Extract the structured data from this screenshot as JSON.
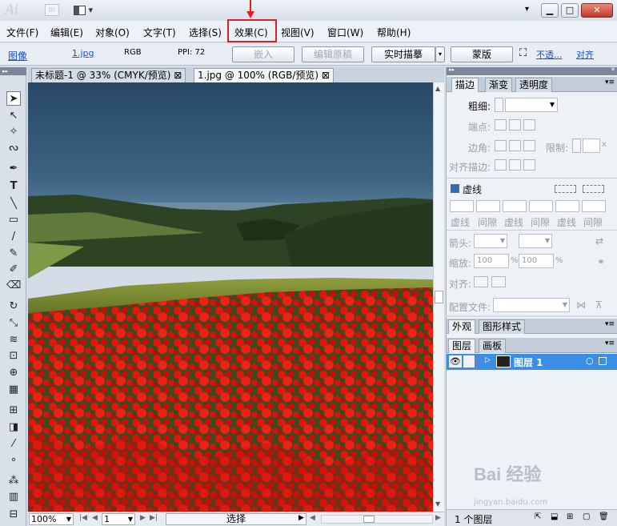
{
  "app": {
    "logo": "Ai",
    "bridge_label": "Br",
    "arrange_icon": "arrange-documents-icon"
  },
  "window_controls": {
    "minimize": "▁",
    "restore": "□",
    "close": "✕"
  },
  "menu": {
    "items": [
      "文件(F)",
      "编辑(E)",
      "对象(O)",
      "文字(T)",
      "选择(S)",
      "效果(C)",
      "视图(V)",
      "窗口(W)",
      "帮助(H)"
    ],
    "highlighted": "效果(C)"
  },
  "control_bar": {
    "type_label": "图像",
    "file_link": "1.jpg",
    "color_mode": "RGB",
    "ppi": "PPI: 72",
    "embed_btn": "嵌入",
    "edit_original_btn": "编辑原稿",
    "live_trace_btn": "实时描摹",
    "mask_btn": "蒙版",
    "opacity_link": "不透...",
    "align_link": "对齐"
  },
  "doc_tabs": [
    {
      "label": "未标题-1 @ 33% (CMYK/预览)",
      "close": "⊠"
    },
    {
      "label": "1.jpg @ 100% (RGB/预览)",
      "close": "⊠"
    }
  ],
  "status_bar": {
    "zoom": "100%",
    "page": "1",
    "tool_state": "选择"
  },
  "stroke_panel": {
    "tabs": [
      "描边",
      "渐变",
      "透明度"
    ],
    "weight_label": "粗细:",
    "cap_label": "端点:",
    "corner_label": "边角:",
    "limit_label": "限制:",
    "limit_suffix": "x",
    "align_label": "对齐描边:",
    "dashed_label": "虚线",
    "dash_labels": [
      "虚线",
      "间隙",
      "虚线",
      "间隙",
      "虚线",
      "间隙"
    ],
    "arrowheads_label": "箭头:",
    "scale_label": "缩放:",
    "scale_value_1": "100",
    "scale_value_2": "100",
    "percent": "%",
    "align_arrow_label": "对齐:",
    "profile_label": "配置文件:"
  },
  "appearance_panel": {
    "tabs": [
      "外观",
      "图形样式"
    ]
  },
  "layers_panel": {
    "tabs": [
      "图层",
      "画板"
    ],
    "layer_name": "图层 1",
    "count": "1 个图层"
  },
  "watermark": {
    "brand": "Bai 经验",
    "url": "jingyan.baidu.com"
  },
  "colors": {
    "highlight": "#e02020",
    "layer_selected": "#3a8ee6",
    "link": "#1c4fc4"
  }
}
